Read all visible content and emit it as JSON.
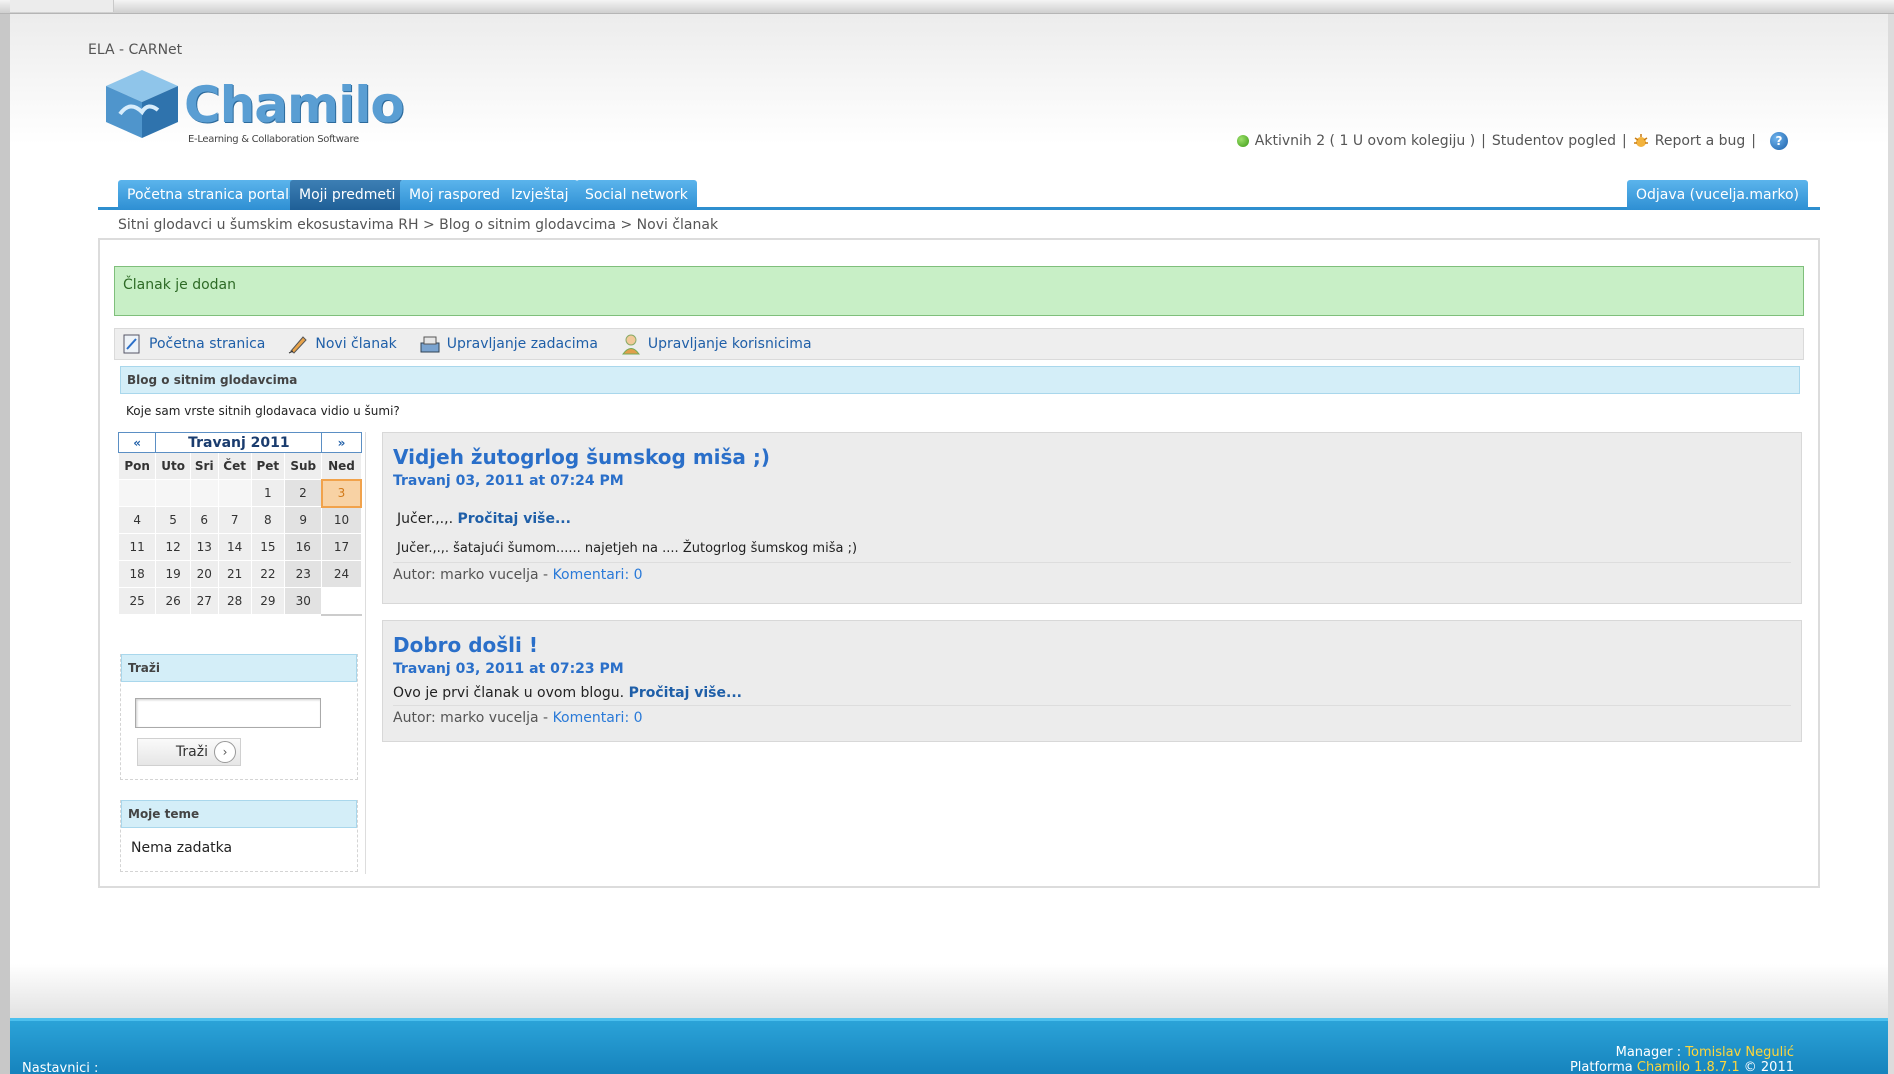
{
  "header": {
    "org_name": "ELA - CARNet",
    "logo_text": "Chamilo",
    "logo_tagline": "E-Learning & Collaboration Software",
    "online_label": "Aktivnih 2  ( 1 U ovom kolegiju  )",
    "student_view": "Studentov pogled",
    "report_bug": "Report a bug",
    "help_glyph": "?"
  },
  "nav": {
    "tabs": [
      {
        "label": "Početna stranica portala"
      },
      {
        "label": "Moji predmeti"
      },
      {
        "label": "Moj raspored"
      },
      {
        "label": "Izvještaj"
      },
      {
        "label": "Social network"
      }
    ],
    "logout": "Odjava (vucelja.marko)"
  },
  "breadcrumb": {
    "course": "Sitni glodavci u šumskim ekosustavima RH",
    "sep": ">",
    "blog": "Blog o sitnim glodavcima",
    "current": "Novi članak"
  },
  "notice": "Članak je dodan",
  "actions": {
    "home": "Početna stranica",
    "new_post": "Novi članak",
    "tasks": "Upravljanje zadacima",
    "users": "Upravljanje korisnicima"
  },
  "blog": {
    "title": "Blog o sitnim glodavcima",
    "subtitle": "Koje sam vrste sitnih glodavaca vidio u šumi?"
  },
  "calendar": {
    "prev": "«",
    "next": "»",
    "month": "Travanj 2011",
    "weekdays": [
      "Pon",
      "Uto",
      "Sri",
      "Čet",
      "Pet",
      "Sub",
      "Ned"
    ],
    "weeks": [
      [
        "",
        "",
        "",
        "",
        "1",
        "2",
        "3"
      ],
      [
        "4",
        "5",
        "6",
        "7",
        "8",
        "9",
        "10"
      ],
      [
        "11",
        "12",
        "13",
        "14",
        "15",
        "16",
        "17"
      ],
      [
        "18",
        "19",
        "20",
        "21",
        "22",
        "23",
        "24"
      ],
      [
        "25",
        "26",
        "27",
        "28",
        "29",
        "30",
        ""
      ]
    ],
    "today": "3"
  },
  "search": {
    "title": "Traži",
    "button": "Traži",
    "value": ""
  },
  "themes": {
    "title": "Moje teme",
    "empty": "Nema zadatka"
  },
  "posts": [
    {
      "title": "Vidjeh žutogrlog šumskog miša ;)",
      "date": "Travanj 03, 2011 at 07:24 PM",
      "excerpt": "Jučer.,.,.",
      "readmore": "Pročitaj više...",
      "body": "Jučer.,.,. šatajući šumom...... najetjeh na .... Žutogrlog šumskog miša ;)",
      "author": "Autor: marko vucelja - ",
      "comments": "Komentari: 0"
    },
    {
      "title": "Dobro došli !",
      "date": "Travanj 03, 2011 at 07:23 PM",
      "excerpt": "Ovo je prvi članak u ovom blogu.",
      "readmore": "Pročitaj više...",
      "author": "Autor: marko vucelja - ",
      "comments": "Komentari: 0"
    }
  ],
  "footer": {
    "teachers": "Nastavnici :",
    "manager_label": "Manager : ",
    "manager_name": "Tomislav Negulić",
    "platform_label": "Platforma ",
    "platform_name": "Chamilo 1.8.7.1",
    "copyright": " © 2011"
  },
  "colors": {
    "accent": "#2e8fd3",
    "link": "#2a6fc9",
    "notice_bg": "#c8efc6",
    "today": "#f8d2a4"
  }
}
